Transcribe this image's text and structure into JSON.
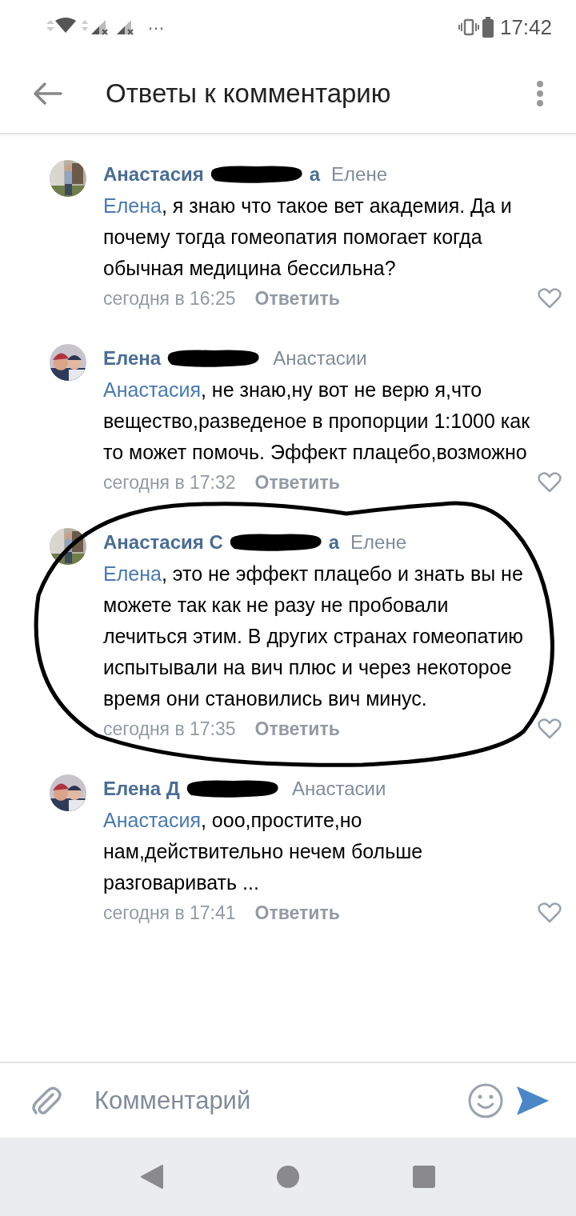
{
  "status_bar": {
    "time": "17:42",
    "more": "…"
  },
  "header": {
    "title": "Ответы к комментарию"
  },
  "comments": [
    {
      "name": "Анастасия",
      "name_end": "а",
      "reply_to": "Елене",
      "mention": "Елена",
      "text": ", я знаю что такое вет академия. Да и почему тогда гомеопатия помогает когда обычная медицина бессильна?",
      "time": "сегодня в 16:25",
      "reply": "Ответить",
      "liked": false,
      "circled": false
    },
    {
      "name": "Елена",
      "reply_to": "Анастасии",
      "mention": "Анастасия",
      "text": ", не знаю,ну вот не верю я,что вещество,разведеное в пропорции 1:1000 как то может помочь. Эффект плацебо,возможно",
      "time": "сегодня в 17:32",
      "reply": "Ответить",
      "liked": false,
      "circled": false
    },
    {
      "name": "Анастасия С",
      "name_end": "а",
      "reply_to": "Елене",
      "mention": "Елена",
      "text": ", это не эффект плацебо и знать вы не можете так как не разу не пробовали лечиться этим. В других странах гомеопатию испытывали на вич плюс и через некоторое время они становились вич минус.",
      "time": "сегодня в 17:35",
      "reply": "Ответить",
      "liked": false,
      "circled": true
    },
    {
      "name": "Елена Д",
      "reply_to": "Анастасии",
      "mention": "Анастасия",
      "text": ", ооо,простите,но нам,действительно нечем больше разговаривать ...",
      "time": "сегодня в 17:41",
      "reply": "Ответить",
      "liked": false,
      "circled": false
    }
  ],
  "composer": {
    "placeholder": "Комментарий"
  }
}
